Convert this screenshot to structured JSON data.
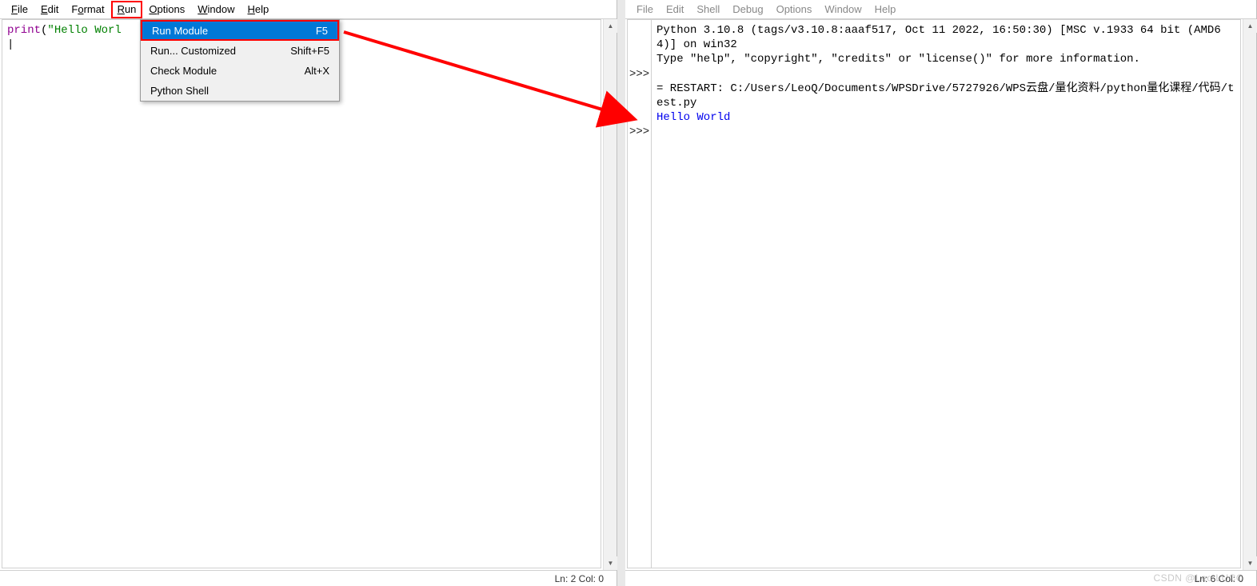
{
  "left_window": {
    "menubar": [
      {
        "label": "File",
        "ul": "F"
      },
      {
        "label": "Edit",
        "ul": "E"
      },
      {
        "label": "Format",
        "ul": "o"
      },
      {
        "label": "Run",
        "ul": "R",
        "highlight": true
      },
      {
        "label": "Options",
        "ul": "O"
      },
      {
        "label": "Window",
        "ul": "W"
      },
      {
        "label": "Help",
        "ul": "H"
      }
    ],
    "code": {
      "fn": "print",
      "paren_open": "(",
      "string": "\"Hello Worl",
      "rest": ""
    },
    "dropdown": [
      {
        "label": "Run Module",
        "shortcut": "F5",
        "selected": true
      },
      {
        "label": "Run... Customized",
        "shortcut": "Shift+F5"
      },
      {
        "label": "Check Module",
        "shortcut": "Alt+X"
      },
      {
        "label": "Python Shell",
        "shortcut": ""
      }
    ],
    "status": "Ln: 2  Col: 0"
  },
  "right_window": {
    "menubar": [
      {
        "label": "File"
      },
      {
        "label": "Edit"
      },
      {
        "label": "Shell"
      },
      {
        "label": "Debug"
      },
      {
        "label": "Options"
      },
      {
        "label": "Window"
      },
      {
        "label": "Help"
      }
    ],
    "shell": {
      "banner1": "Python 3.10.8 (tags/v3.10.8:aaaf517, Oct 11 2022, 16:50:30) [MSC v.1933 64 bit (AMD64)] on win32",
      "banner2": "Type \"help\", \"copyright\", \"credits\" or \"license()\" for more information.",
      "restart": "= RESTART: C:/Users/LeoQ/Documents/WPSDrive/5727926/WPS云盘/量化资料/python量化课程/代码/test.py",
      "output": "Hello World",
      "prompt": ">>>"
    },
    "status": "Ln: 6  Col: 0"
  },
  "watermark": "CSDN @Leo LUCC"
}
